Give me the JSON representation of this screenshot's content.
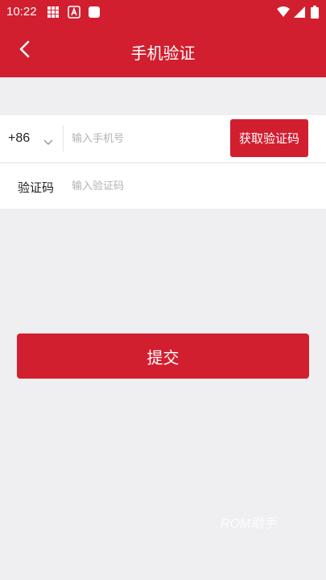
{
  "status_bar": {
    "time": "10:22",
    "icons": [
      "grid-icon",
      "app-a-icon",
      "square-icon",
      "wifi-icon",
      "signal-icon",
      "battery-icon"
    ]
  },
  "header": {
    "title": "手机验证",
    "back_icon": "chevron-left-icon"
  },
  "phone_row": {
    "country_code": "+86",
    "phone_placeholder": "输入手机号",
    "get_code_label": "获取验证码"
  },
  "code_row": {
    "label": "验证码",
    "code_placeholder": "输入验证码"
  },
  "submit_label": "提交",
  "watermark": "ROM助手",
  "colors": {
    "brand": "#d11f30",
    "background": "#efeef0",
    "row_background": "#ffffff",
    "placeholder": "#b3b3b3"
  }
}
